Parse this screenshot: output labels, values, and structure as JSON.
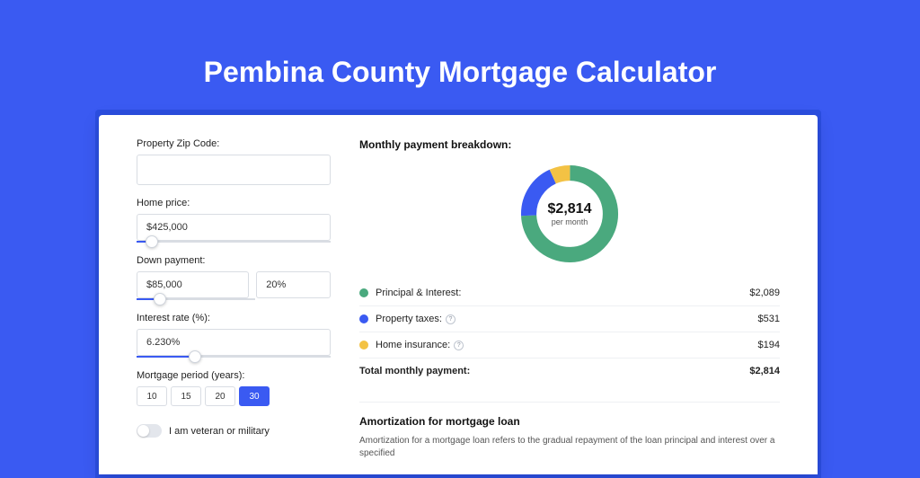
{
  "title": "Pembina County Mortgage Calculator",
  "colors": {
    "green": "#4aa97e",
    "blue": "#3a5af2",
    "yellow": "#f3c244"
  },
  "form": {
    "zip_label": "Property Zip Code:",
    "zip_value": "",
    "home_price_label": "Home price:",
    "home_price_value": "$425,000",
    "home_price_slider_percent": 8,
    "down_payment_label": "Down payment:",
    "down_payment_value": "$85,000",
    "down_payment_percent": "20%",
    "down_payment_slider_percent": 20,
    "interest_label": "Interest rate (%):",
    "interest_value": "6.230%",
    "interest_slider_percent": 30,
    "period_label": "Mortgage period (years):",
    "periods": [
      {
        "label": "10",
        "active": false
      },
      {
        "label": "15",
        "active": false
      },
      {
        "label": "20",
        "active": false
      },
      {
        "label": "30",
        "active": true
      }
    ],
    "veteran_label": "I am veteran or military"
  },
  "breakdown": {
    "title": "Monthly payment breakdown:",
    "donut_value": "$2,814",
    "donut_sub": "per month",
    "items": [
      {
        "color": "#4aa97e",
        "label": "Principal & Interest:",
        "value": "$2,089",
        "info": false
      },
      {
        "color": "#3a5af2",
        "label": "Property taxes:",
        "value": "$531",
        "info": true
      },
      {
        "color": "#f3c244",
        "label": "Home insurance:",
        "value": "$194",
        "info": true
      }
    ],
    "total_label": "Total monthly payment:",
    "total_value": "$2,814"
  },
  "amort": {
    "title": "Amortization for mortgage loan",
    "text": "Amortization for a mortgage loan refers to the gradual repayment of the loan principal and interest over a specified"
  },
  "chart_data": {
    "type": "pie",
    "title": "Monthly payment breakdown",
    "series": [
      {
        "name": "Principal & Interest",
        "value": 2089,
        "color": "#4aa97e"
      },
      {
        "name": "Property taxes",
        "value": 531,
        "color": "#3a5af2"
      },
      {
        "name": "Home insurance",
        "value": 194,
        "color": "#f3c244"
      }
    ],
    "total": 2814,
    "center_label": "$2,814 per month"
  }
}
